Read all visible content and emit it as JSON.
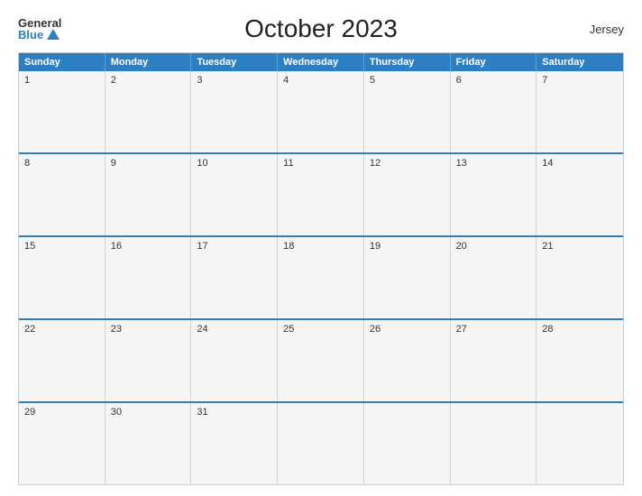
{
  "header": {
    "title": "October 2023",
    "location": "Jersey",
    "logo_general": "General",
    "logo_blue": "Blue"
  },
  "calendar": {
    "day_headers": [
      "Sunday",
      "Monday",
      "Tuesday",
      "Wednesday",
      "Thursday",
      "Friday",
      "Saturday"
    ],
    "weeks": [
      [
        {
          "day": "1",
          "empty": false
        },
        {
          "day": "2",
          "empty": false
        },
        {
          "day": "3",
          "empty": false
        },
        {
          "day": "4",
          "empty": false
        },
        {
          "day": "5",
          "empty": false
        },
        {
          "day": "6",
          "empty": false
        },
        {
          "day": "7",
          "empty": false
        }
      ],
      [
        {
          "day": "8",
          "empty": false
        },
        {
          "day": "9",
          "empty": false
        },
        {
          "day": "10",
          "empty": false
        },
        {
          "day": "11",
          "empty": false
        },
        {
          "day": "12",
          "empty": false
        },
        {
          "day": "13",
          "empty": false
        },
        {
          "day": "14",
          "empty": false
        }
      ],
      [
        {
          "day": "15",
          "empty": false
        },
        {
          "day": "16",
          "empty": false
        },
        {
          "day": "17",
          "empty": false
        },
        {
          "day": "18",
          "empty": false
        },
        {
          "day": "19",
          "empty": false
        },
        {
          "day": "20",
          "empty": false
        },
        {
          "day": "21",
          "empty": false
        }
      ],
      [
        {
          "day": "22",
          "empty": false
        },
        {
          "day": "23",
          "empty": false
        },
        {
          "day": "24",
          "empty": false
        },
        {
          "day": "25",
          "empty": false
        },
        {
          "day": "26",
          "empty": false
        },
        {
          "day": "27",
          "empty": false
        },
        {
          "day": "28",
          "empty": false
        }
      ],
      [
        {
          "day": "29",
          "empty": false
        },
        {
          "day": "30",
          "empty": false
        },
        {
          "day": "31",
          "empty": false
        },
        {
          "day": "",
          "empty": true
        },
        {
          "day": "",
          "empty": true
        },
        {
          "day": "",
          "empty": true
        },
        {
          "day": "",
          "empty": true
        }
      ]
    ]
  }
}
